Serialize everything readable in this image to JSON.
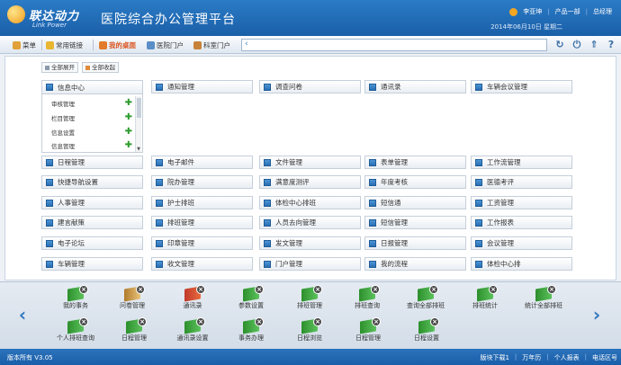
{
  "header": {
    "logo_text": "联达动力",
    "logo_sub": "Link Power",
    "app_title": "医院综合办公管理平台",
    "user_name": "李亚坤",
    "department": "产品一部",
    "role": "总经理",
    "date_line": "2014年06月10日  星期二"
  },
  "navbar": {
    "items": [
      {
        "label": "菜单"
      },
      {
        "label": "常用链接"
      },
      {
        "label": "我的桌面"
      },
      {
        "label": "医院门户"
      },
      {
        "label": "科室门户"
      }
    ],
    "track_arrow": "‹"
  },
  "toggles": {
    "expand_all": "全部展开",
    "collapse_all": "全部收起"
  },
  "info_center": {
    "title": "信息中心",
    "subitems": [
      "审核管理",
      "栏目管理",
      "信息设置",
      "信息管理"
    ]
  },
  "modules": [
    "通知管理",
    "调查问卷",
    "通讯录",
    "车辆会议管理",
    "日程管理",
    "电子邮件",
    "文件管理",
    "表单管理",
    "工作流管理",
    "快捷导航设置",
    "院办管理",
    "满意度测评",
    "年度考核",
    "医德考评",
    "人事管理",
    "护士排班",
    "体检中心排班",
    "短信通",
    "工资管理",
    "建言献策",
    "排班管理",
    "人员去向管理",
    "短信管理",
    "工作报表",
    "电子论坛",
    "印章管理",
    "发文管理",
    "日报管理",
    "会议管理",
    "车辆管理",
    "收文管理",
    "门户管理",
    "我的流程",
    "体检中心排"
  ],
  "dock": {
    "items": [
      {
        "label": "我的事务",
        "icon": "book-green-icon"
      },
      {
        "label": "问卷管理",
        "icon": "notebook-icon"
      },
      {
        "label": "通讯录",
        "icon": "book-red-icon"
      },
      {
        "label": "参数设置",
        "icon": "book-green-icon"
      },
      {
        "label": "排班管理",
        "icon": "book-green-icon"
      },
      {
        "label": "排班查询",
        "icon": "book-green-icon"
      },
      {
        "label": "查询全部排班",
        "icon": "book-green-icon"
      },
      {
        "label": "排班统计",
        "icon": "book-green-icon"
      },
      {
        "label": "统计全部排班",
        "icon": "book-green-icon"
      },
      {
        "label": "个人排班查询",
        "icon": "book-green-icon"
      },
      {
        "label": "日程管理",
        "icon": "book-green-icon"
      },
      {
        "label": "通讯录设置",
        "icon": "book-green-icon"
      },
      {
        "label": "事务办理",
        "icon": "book-green-icon"
      },
      {
        "label": "日程浏览",
        "icon": "book-green-icon"
      },
      {
        "label": "日程管理",
        "icon": "book-green-icon"
      },
      {
        "label": "日程设置",
        "icon": "book-green-icon"
      }
    ]
  },
  "statusbar": {
    "copyright": "版本所有 V3.05",
    "links": [
      "版块下载1",
      "万年历",
      "个人报表",
      "电话区号"
    ]
  }
}
